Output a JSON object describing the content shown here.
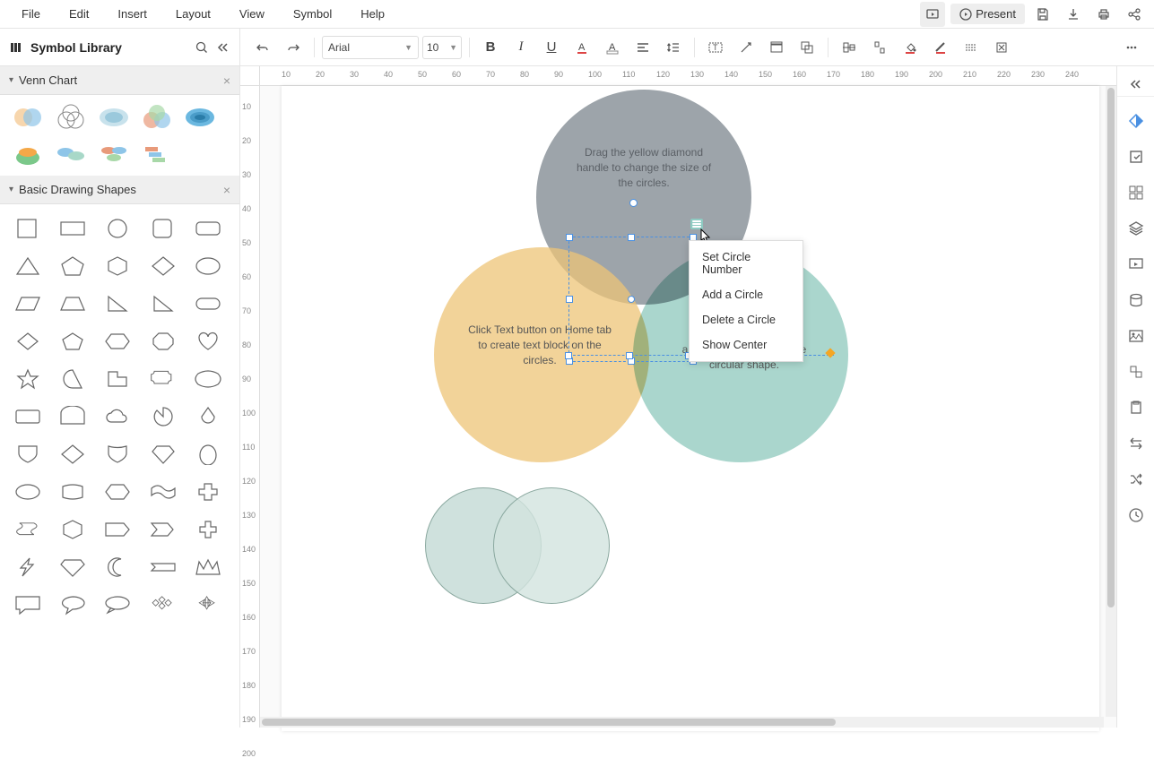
{
  "menubar": {
    "items": [
      "File",
      "Edit",
      "Insert",
      "Layout",
      "View",
      "Symbol",
      "Help"
    ],
    "present": "Present"
  },
  "library": {
    "title": "Symbol Library",
    "sections": {
      "venn": "Venn Chart",
      "basic": "Basic Drawing Shapes"
    }
  },
  "toolbar": {
    "font": "Arial",
    "size": "10"
  },
  "canvas": {
    "circle_gray_text": "Drag the yellow diamond handle to change the size of the circles.",
    "circle_yellow_text": "Click Text button on Home tab to create text block on the circles.",
    "circle_teal_text": "a or remove a circle of the circular shape."
  },
  "context_menu": {
    "items": [
      "Set Circle Number",
      "Add a Circle",
      "Delete a Circle",
      "Show Center"
    ]
  },
  "ruler_h": [
    "10",
    "20",
    "30",
    "40",
    "50",
    "60",
    "70",
    "80",
    "90",
    "100",
    "110",
    "120",
    "130",
    "140",
    "150",
    "160",
    "170",
    "180",
    "190",
    "200",
    "210",
    "220",
    "230",
    "240"
  ],
  "ruler_v": [
    "10",
    "20",
    "30",
    "40",
    "50",
    "60",
    "70",
    "80",
    "90",
    "100",
    "110",
    "120",
    "130",
    "140",
    "150",
    "160",
    "170",
    "180",
    "190",
    "200"
  ]
}
